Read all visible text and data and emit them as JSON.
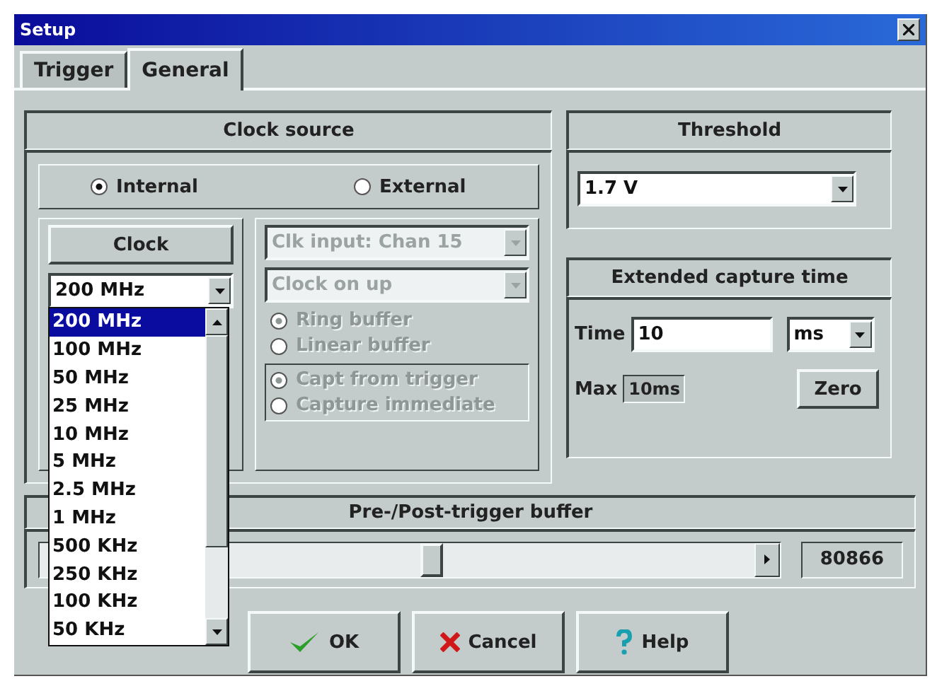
{
  "window": {
    "title": "Setup"
  },
  "tabs": [
    {
      "label": "Trigger",
      "selected": false
    },
    {
      "label": "General",
      "selected": true
    }
  ],
  "clock_source": {
    "title": "Clock source",
    "modes": [
      {
        "label": "Internal",
        "selected": true
      },
      {
        "label": "External",
        "selected": false
      }
    ],
    "clock": {
      "title": "Clock",
      "value": "200 MHz",
      "expanded": true,
      "options": [
        {
          "label": "200 MHz",
          "selected": true
        },
        {
          "label": "100 MHz",
          "selected": false
        },
        {
          "label": "50 MHz",
          "selected": false
        },
        {
          "label": "25 MHz",
          "selected": false
        },
        {
          "label": "10 MHz",
          "selected": false
        },
        {
          "label": "5 MHz",
          "selected": false
        },
        {
          "label": "2.5 MHz",
          "selected": false
        },
        {
          "label": "1 MHz",
          "selected": false
        },
        {
          "label": "500 KHz",
          "selected": false
        },
        {
          "label": "250 KHz",
          "selected": false
        },
        {
          "label": "100 KHz",
          "selected": false
        },
        {
          "label": "50 KHz",
          "selected": false
        }
      ]
    },
    "external": {
      "disabled": true,
      "input": "Clk input: Chan 15",
      "edge": "Clock on up",
      "buffer_modes": [
        {
          "label": "Ring buffer",
          "selected": true
        },
        {
          "label": "Linear buffer",
          "selected": false
        }
      ],
      "capture_modes": [
        {
          "label": "Capt from trigger",
          "selected": true
        },
        {
          "label": "Capture immediate",
          "selected": false
        }
      ]
    }
  },
  "threshold": {
    "title": "Threshold",
    "value": "1.7 V"
  },
  "extended_capture": {
    "title": "Extended capture time",
    "time_label": "Time",
    "time": "10",
    "unit": "ms",
    "max_label": "Max",
    "max": "10ms",
    "zero_button": "Zero"
  },
  "buffer": {
    "title": "Pre-/Post-trigger buffer",
    "level": 0.53,
    "value": "80866"
  },
  "buttons": [
    {
      "label": "OK",
      "kind": "ok"
    },
    {
      "label": "Cancel",
      "kind": "cancel"
    },
    {
      "label": "Help",
      "kind": "help"
    }
  ]
}
